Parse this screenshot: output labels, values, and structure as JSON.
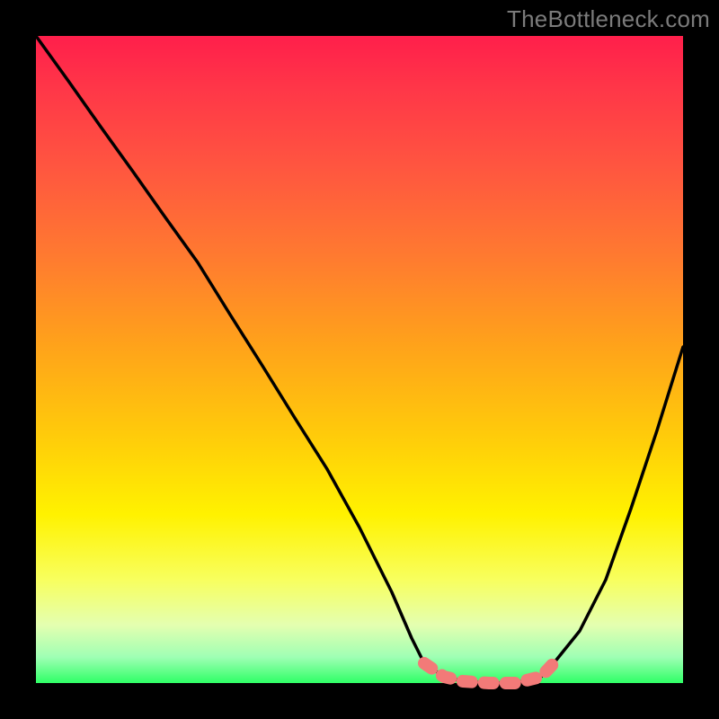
{
  "watermark": "TheBottleneck.com",
  "chart_data": {
    "type": "line",
    "title": "",
    "xlabel": "",
    "ylabel": "",
    "x_range": [
      0,
      100
    ],
    "y_range": [
      0,
      100
    ],
    "series": [
      {
        "name": "bottleneck-curve",
        "x": [
          0,
          5,
          10,
          15,
          20,
          25,
          30,
          35,
          40,
          45,
          50,
          55,
          58,
          60,
          63,
          66,
          70,
          74,
          78,
          80,
          84,
          88,
          92,
          96,
          100
        ],
        "y": [
          100,
          93,
          86,
          79,
          72,
          65,
          57,
          49,
          41,
          33,
          24,
          14,
          7,
          3,
          1,
          0,
          0,
          0,
          1,
          3,
          8,
          16,
          27,
          39,
          52
        ]
      },
      {
        "name": "highlight-band",
        "x": [
          60,
          63,
          66,
          70,
          74,
          78,
          80
        ],
        "y": [
          3,
          1,
          0,
          0,
          0,
          1,
          3
        ]
      }
    ],
    "colors": {
      "curve": "#000000",
      "highlight": "#f27a78",
      "gradient_top": "#ff1f4b",
      "gradient_bottom": "#2fff66"
    },
    "notes": "Axes unlabeled in source. x expressed as 0-100 across width; y as 0 (bottom) to 100 (top). Curve descends steeply from top-left, reaches a flat minimum around x≈60-80, then rises toward the right edge to about half height."
  }
}
